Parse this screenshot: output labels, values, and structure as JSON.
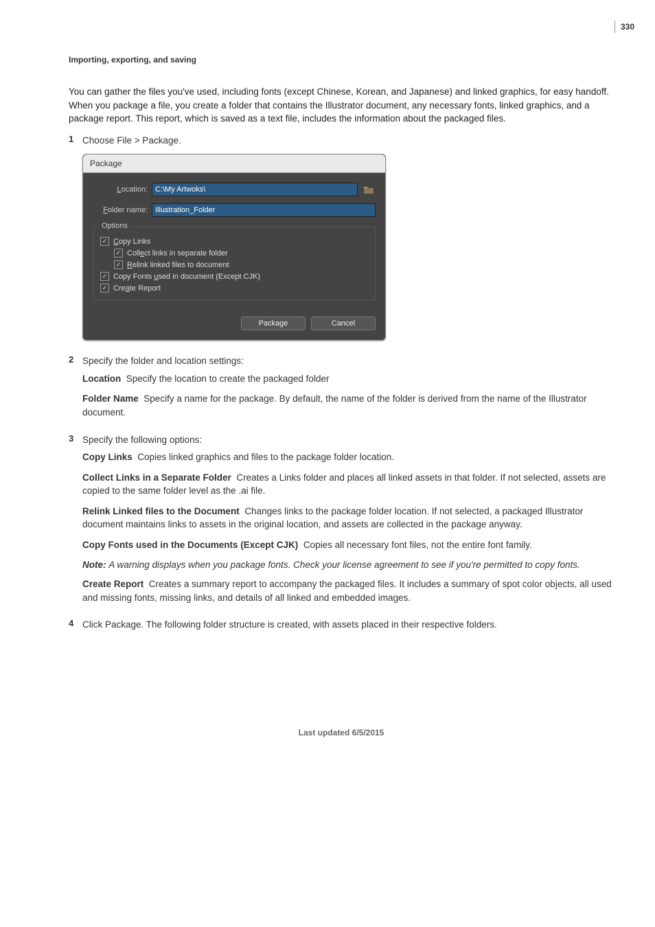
{
  "page_number": "330",
  "section_header": "Importing, exporting, and saving",
  "intro": "You can gather the files you've used, including fonts (except Chinese, Korean, and Japanese) and linked graphics, for easy handoff. When you package a file, you create a folder that contains the Illustrator document, any necessary fonts, linked graphics, and a package report. This report, which is saved as a text file, includes the information about the packaged files.",
  "steps": {
    "s1": {
      "num": "1",
      "text": "Choose File > Package."
    },
    "s2": {
      "num": "2",
      "text": "Specify the folder and location settings:"
    },
    "s3": {
      "num": "3",
      "text": "Specify the following options:"
    },
    "s4": {
      "num": "4",
      "text": "Click Package. The following folder structure is created, with assets placed in their respective folders."
    }
  },
  "defs": {
    "location": {
      "term": "Location",
      "text": "Specify the location to create the packaged folder"
    },
    "foldername": {
      "term": "Folder Name",
      "text": "Specify a name for the package. By default, the name of the folder is derived from the name of the Illustrator document."
    },
    "copylinks": {
      "term": "Copy Links",
      "text": "Copies linked graphics and files to the package folder location."
    },
    "collect": {
      "term": "Collect Links in a Separate Folder",
      "text": "Creates a Links folder and places all linked assets in that folder. If not selected, assets are copied to the same folder level as the .ai file."
    },
    "relink": {
      "term": "Relink Linked files to the Document",
      "text": "Changes links to the package folder location. If not selected, a packaged Illustrator document maintains links to assets in the original location, and assets are collected in the package anyway."
    },
    "copyfonts": {
      "term": "Copy Fonts used in the Documents (Except CJK)",
      "text": "Copies all necessary font files, not the entire font family."
    },
    "createreport": {
      "term": "Create Report",
      "text": "Creates a summary report to accompany the packaged files. It includes a summary of spot color objects, all used and missing fonts, missing links, and details of all linked and embedded images."
    }
  },
  "note": {
    "label": "Note:",
    "text": "A warning displays when you package fonts. Check your license agreement to see if you're permitted to copy fonts."
  },
  "dialog": {
    "title": "Package",
    "location_label": "Location:",
    "location_label_ul": "L",
    "location_value": "C:\\My Artwoks\\",
    "foldername_label": "Folder name:",
    "foldername_label_ul": "F",
    "foldername_value": "Illustration_Folder",
    "options_label": "Options",
    "chk_copylinks": {
      "ul": "C",
      "rest": "opy Links"
    },
    "chk_collect": {
      "pre": "Coll",
      "ul": "e",
      "rest": "ct links in separate folder"
    },
    "chk_relink": {
      "ul": "R",
      "rest": "elink linked files to document"
    },
    "chk_copyfonts": {
      "pre": "Copy Fonts ",
      "ul": "u",
      "rest": "sed in document (Except CJK)"
    },
    "chk_createreport": {
      "pre": "Cre",
      "ul": "a",
      "rest": "te Report"
    },
    "btn_package": "Package",
    "btn_cancel": "Cancel"
  },
  "footer": "Last updated 6/5/2015"
}
